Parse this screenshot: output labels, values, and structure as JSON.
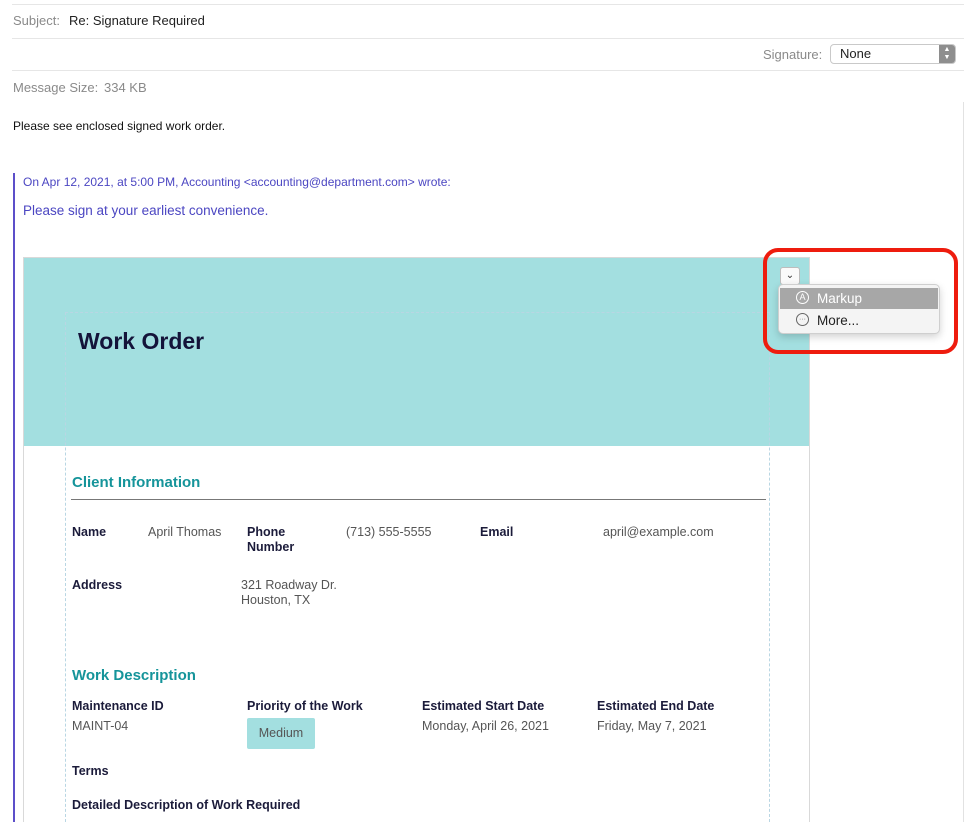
{
  "header": {
    "subject_label": "Subject:",
    "subject_value": "Re: Signature Required",
    "signature_label": "Signature:",
    "signature_value": "None",
    "message_size_label": "Message Size:",
    "message_size_value": "334 KB"
  },
  "body": {
    "message": "Please see enclosed signed work order.",
    "quote_header": "On Apr 12, 2021, at 5:00 PM, Accounting <accounting@department.com> wrote:",
    "quote_text": "Please sign at your earliest convenience."
  },
  "menu": {
    "items": [
      {
        "label": "Markup",
        "icon": "markup-icon",
        "selected": true
      },
      {
        "label": "More...",
        "icon": "more-icon",
        "selected": false
      }
    ]
  },
  "work_order": {
    "title": "Work Order",
    "client_section": "Client Information",
    "name_label": "Name",
    "name_value": "April Thomas",
    "phone_label_1": "Phone",
    "phone_label_2": "Number",
    "phone_value": "(713) 555-5555",
    "email_label": "Email",
    "email_value": "april@example.com",
    "address_label": "Address",
    "address_line1": "321 Roadway Dr.",
    "address_line2": "Houston, TX",
    "work_section": "Work Description",
    "maint_label": "Maintenance ID",
    "maint_value": "MAINT-04",
    "priority_label": "Priority of the Work",
    "priority_value": "Medium",
    "start_label": "Estimated Start Date",
    "start_value": "Monday, April 26, 2021",
    "end_label": "Estimated End Date",
    "end_value": "Friday, May 7, 2021",
    "terms_label": "Terms",
    "detail_label": "Detailed Description of Work Required"
  },
  "colors": {
    "banner": "#a3dfe0",
    "section_heading": "#15949a",
    "quote_bar": "#5c4fc9",
    "highlight": "#ee1c0e"
  }
}
